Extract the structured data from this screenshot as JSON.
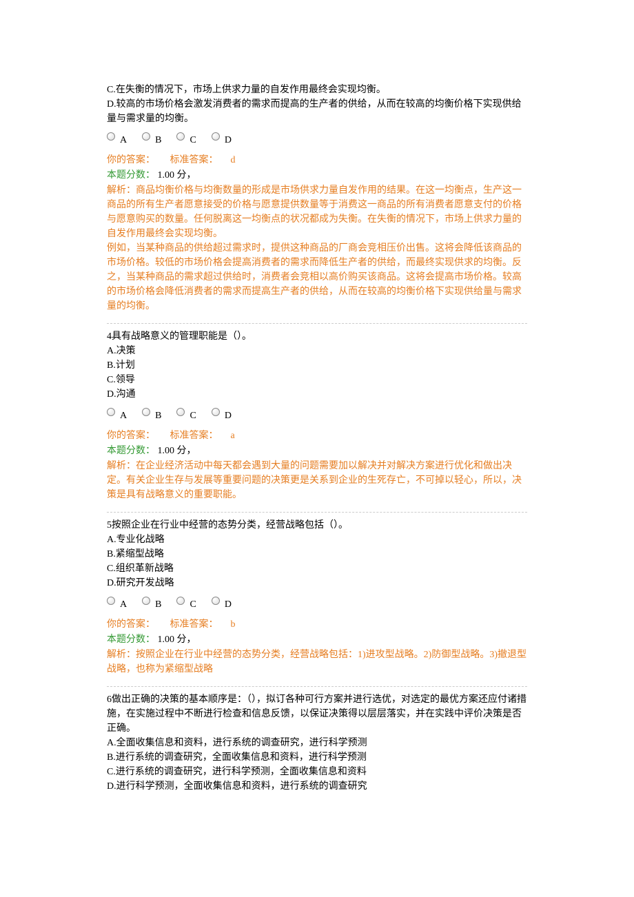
{
  "q3_partial": {
    "optC": "C.在失衡的情况下，市场上供求力量的自发作用最终会实现均衡。",
    "optD": "D.较高的市场价格会激发消费者的需求而提高的生产者的供给，从而在较高的均衡价格下实现供给量与需求量的均衡。",
    "radios": {
      "a": "A",
      "b": "B",
      "c": "C",
      "d": "D"
    },
    "your_answer_label": "你的答案：",
    "std_answer_label": "标准答案：",
    "std_answer": "d",
    "score_label": "本题分数：",
    "score_value": "1.00 分，",
    "analysis_label": "解析：",
    "analysis_text1": "商品均衡价格与均衡数量的形成是市场供求力量自发作用的结果。在这一均衡点，生产这一商品的所有生产者愿意接受的价格与愿意提供数量等于消费这一商品的所有消费者愿意支付的价格与愿意购买的数量。任何脱离这一均衡点的状况都成为失衡。在失衡的情况下，市场上供求力量的自发作用最终会实现均衡。",
    "analysis_text2": "例如，当某种商品的供给超过需求时，提供这种商品的厂商会竞相压价出售。这将会降低该商品的市场价格。较低的市场价格会提高消费者的需求而降低生产者的供给，而最终实现供求的均衡。反之，当某种商品的需求超过供给时，消费者会竞相以高价购买该商品。这将会提高市场价格。较高的市场价格会降低消费者的需求而提高生产者的供给，从而在较高的均衡价格下实现供给量与需求量的均衡。"
  },
  "q4": {
    "num": "4",
    "stem": "具有战略意义的管理职能是（）。",
    "optA": "A.决策",
    "optB": "B.计划",
    "optC": "C.领导",
    "optD": "D.沟通",
    "radios": {
      "a": "A",
      "b": "B",
      "c": "C",
      "d": "D"
    },
    "your_answer_label": "你的答案：",
    "std_answer_label": "标准答案：",
    "std_answer": "a",
    "score_label": "本题分数：",
    "score_value": "1.00 分，",
    "analysis_label": "解析：",
    "analysis_text": "在企业经济活动中每天都会遇到大量的问题需要加以解决并对解决方案进行优化和做出决定。有关企业生存与发展等重要问题的决策更是关系到企业的生死存亡，不可掉以轻心，所以，决策是具有战略意义的重要职能。"
  },
  "q5": {
    "num": "5",
    "stem": "按照企业在行业中经营的态势分类，经营战略包括（）。",
    "optA": "A.专业化战略",
    "optB": "B.紧缩型战略",
    "optC": "C.组织革新战略",
    "optD": "D.研究开发战略",
    "radios": {
      "a": "A",
      "b": "B",
      "c": "C",
      "d": "D"
    },
    "your_answer_label": "你的答案：",
    "std_answer_label": "标准答案：",
    "std_answer": "b",
    "score_label": "本题分数：",
    "score_value": "1.00 分，",
    "analysis_label": "解析：",
    "analysis_text": "按照企业在行业中经营的态势分类，经营战略包括：1)进攻型战略。2)防御型战略。3)撤退型战略，也称为紧缩型战略"
  },
  "q6": {
    "num": "6",
    "stem": "做出正确的决策的基本顺序是：（），拟订各种可行方案并进行选优，对选定的最优方案还应付诸措施，在实施过程中不断进行检查和信息反馈，以保证决策得以层层落实，并在实践中评价决策是否正确。",
    "optA": "A.全面收集信息和资料，进行系统的调查研究，进行科学预测",
    "optB": "B.进行系统的调查研究，全面收集信息和资料，进行科学预测",
    "optC": "C.进行系统的调查研究，进行科学预测，全面收集信息和资料",
    "optD": "D.进行科学预测，全面收集信息和资料，进行系统的调查研究"
  }
}
